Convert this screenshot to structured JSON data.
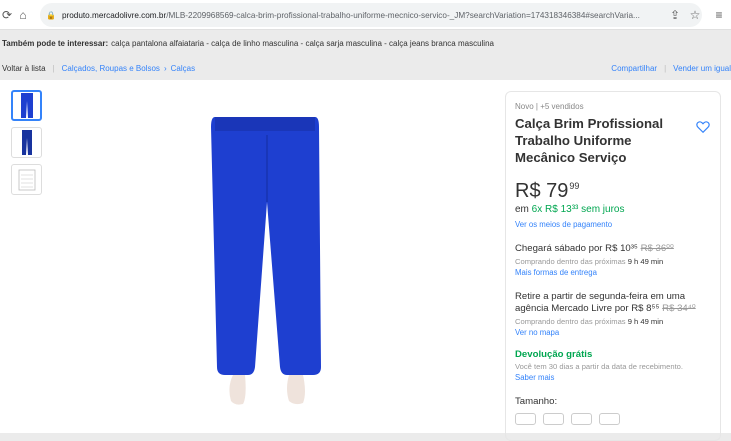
{
  "browser": {
    "url_main": "produto.mercadolivre.com.br",
    "url_rest": "/MLB-2209968569-calca-brim-profissional-trabalho-uniforme-mecnico-servico-_JM?searchVariation=174318346384#searchVaria..."
  },
  "interest": {
    "label": "Também pode te interessar:",
    "items": "calça pantalona alfaiataria - calça de linho masculina - calça sarja masculina - calça jeans branca masculina"
  },
  "crumbs": {
    "back": "Voltar à lista",
    "category": "Calçados, Roupas e Bolsos",
    "subcategory": "Calças",
    "share": "Compartilhar",
    "sell": "Vender um igual"
  },
  "product": {
    "meta": "Novo  |  +5 vendidos",
    "title": "Calça Brim Profissional Trabalho Uniforme Mecânico Serviço",
    "price_int": "R$ 79",
    "price_cents": "99",
    "installment_prefix": "em ",
    "installment_green": "6x R$ 13³³ sem juros",
    "payment_link": "Ver os meios de pagamento",
    "ship_text": "Chegará sábado por R$ 10³⁵ ",
    "ship_old": "R$ 36⁰⁰",
    "ship_sub_prefix": "Comprando dentro das próximas ",
    "ship_time": "9 h 49 min",
    "ship_link": "Mais formas de entrega",
    "pickup_text": "Retire a partir de segunda-feira em uma agência Mercado Livre por R$ 8⁵⁵ ",
    "pickup_old": "R$ 34⁴⁰",
    "pickup_sub_prefix": "Comprando dentro das próximas ",
    "pickup_time": "9 h 49 min",
    "map_link": "Ver no mapa",
    "return_title": "Devolução grátis",
    "return_sub": "Você tem 30 dias a partir da data de recebimento.",
    "return_link": "Saber mais",
    "size_label": "Tamanho:"
  },
  "colors": {
    "accent": "#3483fa",
    "green": "#00a650",
    "pants": "#1e3fd0"
  }
}
